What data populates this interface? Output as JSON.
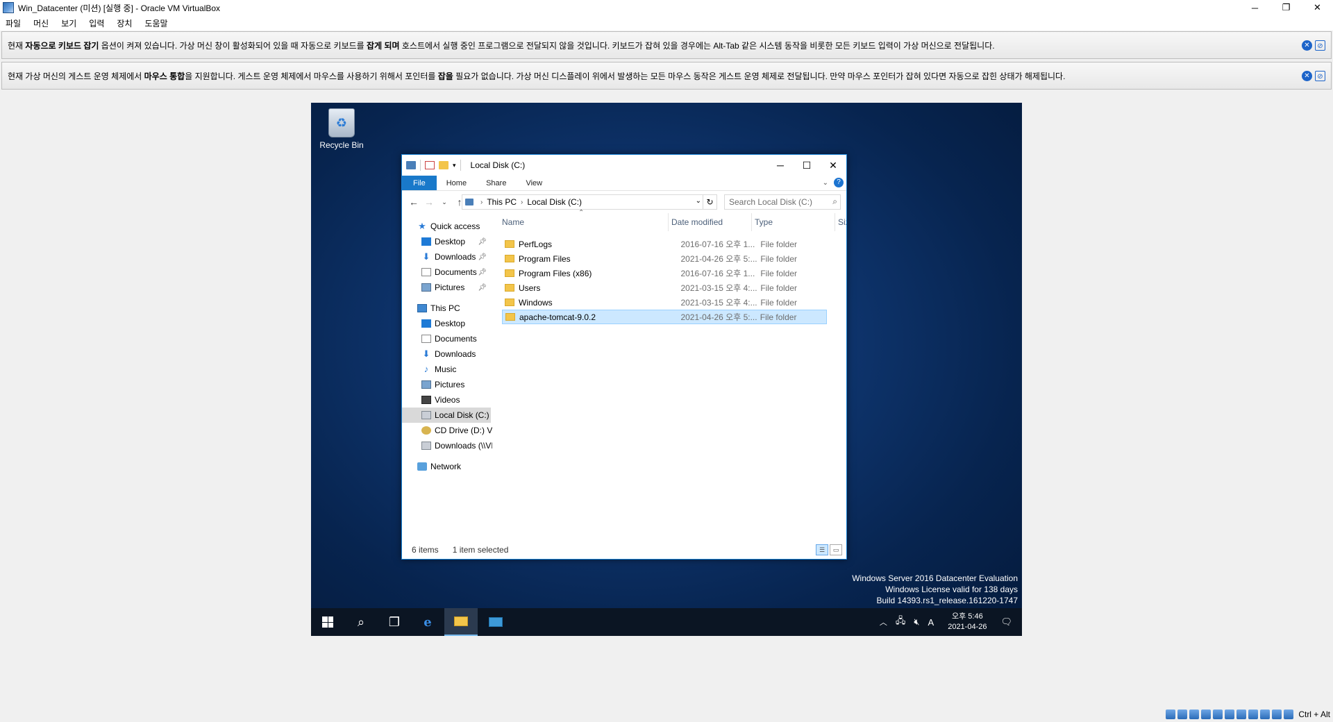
{
  "vbox": {
    "title": "Win_Datacenter (미션) [실행 중] - Oracle VM VirtualBox",
    "menu": [
      "파일",
      "머신",
      "보기",
      "입력",
      "장치",
      "도움말"
    ],
    "notice1": {
      "p1": "현재 ",
      "b1": "자동으로 키보드 잡기",
      "p2": " 옵션이 켜져 있습니다. 가상 머신 창이 활성화되어 있을 때 자동으로 키보드를 ",
      "b2": "잡게 되며",
      "p3": " 호스트에서 실행 중인 프로그램으로 전달되지 않을 것입니다. 키보드가 잡혀 있을 경우에는 Alt-Tab 같은 시스템 동작을 비롯한 모든 키보드 입력이 가상 머신으로 전달됩니다."
    },
    "notice2": {
      "p1": "현재 가상 머신의 게스트 운영 체제에서 ",
      "b1": "마우스 통합",
      "p2": "을 지원합니다. 게스트 운영 체제에서 마우스를 사용하기 위해서 포인터를 ",
      "b2": "잡을",
      "p3": " 필요가 없습니다. 가상 머신 디스플레이 위에서 발생하는 모든 마우스 동작은 게스트 운영 체제로 전달됩니다. 만약 마우스 포인터가 잡혀 있다면 자동으로 잡힌 상태가 해제됩니다."
    },
    "host_key": "Ctrl + Alt"
  },
  "desktop": {
    "recycle_bin": "Recycle Bin",
    "watermark": [
      "Windows Server 2016 Datacenter Evaluation",
      "Windows License valid for 138 days",
      "Build 14393.rs1_release.161220-1747"
    ]
  },
  "taskbar": {
    "time": "오후 5:46",
    "date": "2021-04-26",
    "ime": "A"
  },
  "explorer": {
    "title": "Local Disk (C:)",
    "ribbon_tabs": [
      "File",
      "Home",
      "Share",
      "View"
    ],
    "breadcrumb": [
      "This PC",
      "Local Disk (C:)"
    ],
    "search_placeholder": "Search Local Disk (C:)",
    "nav": {
      "quick_access": "Quick access",
      "qa_items": [
        "Desktop",
        "Downloads",
        "Documents",
        "Pictures"
      ],
      "this_pc": "This PC",
      "pc_items": [
        "Desktop",
        "Documents",
        "Downloads",
        "Music",
        "Pictures",
        "Videos",
        "Local Disk (C:)",
        "CD Drive (D:) Virtua",
        "Downloads (\\\\VBox"
      ],
      "network": "Network"
    },
    "columns": [
      "Name",
      "Date modified",
      "Type",
      "Size"
    ],
    "rows": [
      {
        "name": "PerfLogs",
        "date": "2016-07-16 오후 1...",
        "type": "File folder"
      },
      {
        "name": "Program Files",
        "date": "2021-04-26 오후 5:...",
        "type": "File folder"
      },
      {
        "name": "Program Files (x86)",
        "date": "2016-07-16 오후 1...",
        "type": "File folder"
      },
      {
        "name": "Users",
        "date": "2021-03-15 오후 4:...",
        "type": "File folder"
      },
      {
        "name": "Windows",
        "date": "2021-03-15 오후 4:...",
        "type": "File folder"
      },
      {
        "name": "apache-tomcat-9.0.2",
        "date": "2021-04-26 오후 5:...",
        "type": "File folder"
      }
    ],
    "status_items": "6 items",
    "status_selected": "1 item selected"
  }
}
